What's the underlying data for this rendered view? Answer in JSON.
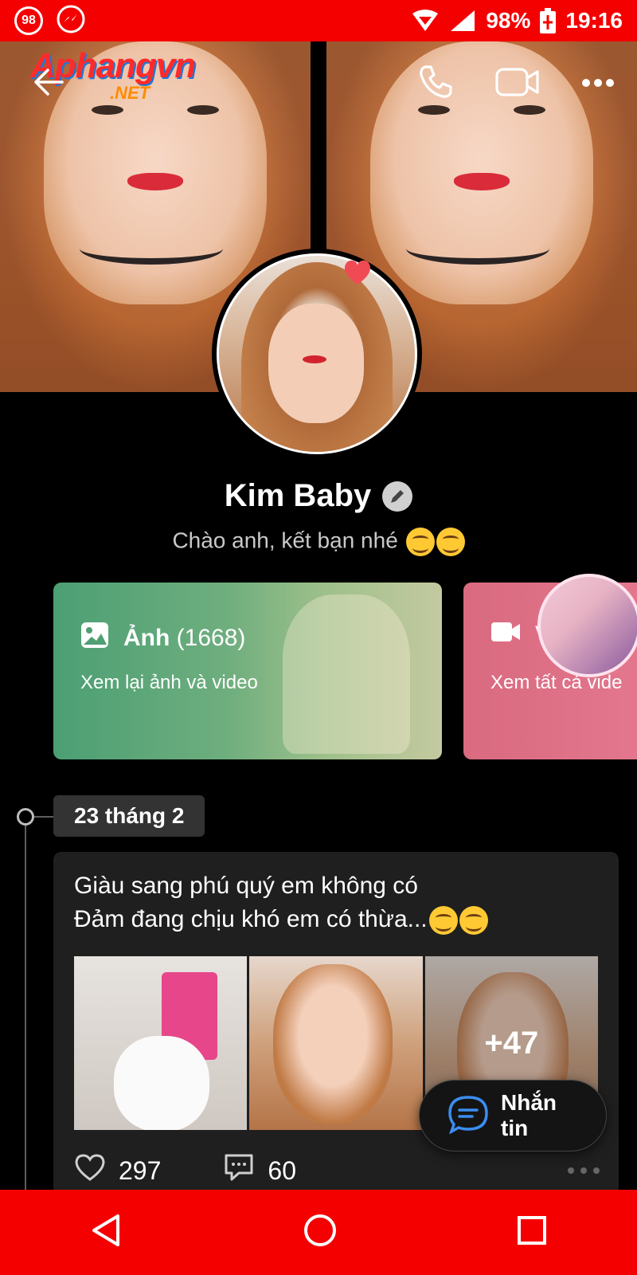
{
  "status_bar": {
    "notification_count": "98",
    "battery": "98%",
    "time": "19:16",
    "bg_color": "#f40000"
  },
  "watermark": {
    "main": "Aphangvn",
    "sub": ".NET"
  },
  "profile": {
    "name": "Kim Baby",
    "status": "Chào anh, kết bạn nhé"
  },
  "cards": {
    "photos": {
      "title": "Ảnh",
      "count": "(1668)",
      "subtitle": "Xem lại ảnh và video"
    },
    "videos": {
      "title": "V",
      "subtitle": "Xem tất cả vide"
    }
  },
  "timeline": {
    "date": "23 tháng 2"
  },
  "post": {
    "line1": "Giàu sang phú quý em không có",
    "line2": "Đảm đang chịu khó em có thừa...",
    "more_photos": "+47",
    "likes": "297",
    "comments": "60"
  },
  "fab": {
    "label": "Nhắn tin"
  },
  "icons": [
    "back-arrow-icon",
    "phone-icon",
    "video-call-icon",
    "more-icon",
    "edit-icon",
    "image-icon",
    "video-icon",
    "heart-icon",
    "comment-icon",
    "chat-bubble-icon",
    "nav-back-icon",
    "nav-home-icon",
    "nav-recents-icon"
  ]
}
